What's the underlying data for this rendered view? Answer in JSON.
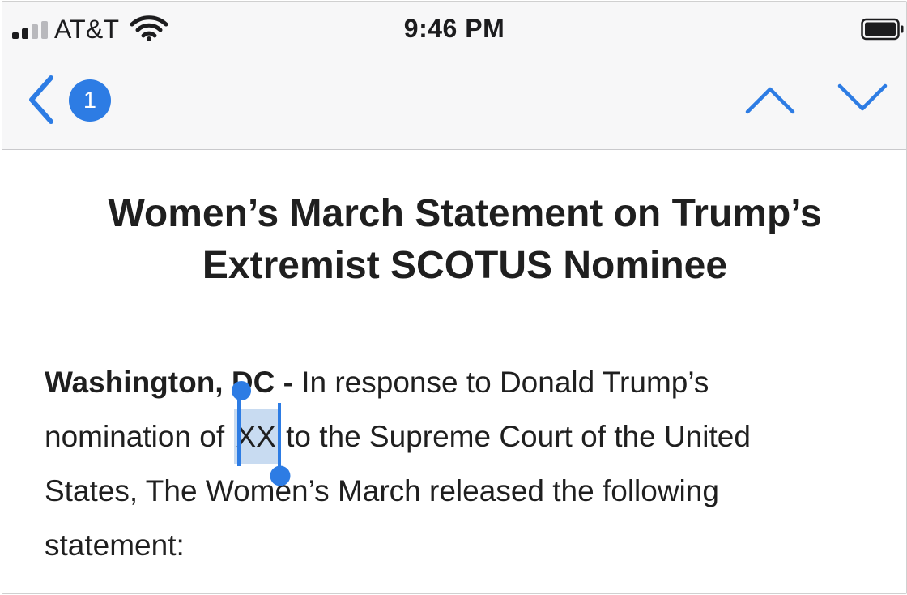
{
  "status_bar": {
    "carrier": "AT&T",
    "time": "9:46 PM",
    "signal_icon": "signal-bars-icon",
    "wifi_icon": "wifi-icon",
    "battery_icon": "battery-icon",
    "signal_bars_active": 2,
    "signal_bars_total": 4
  },
  "nav_bar": {
    "back_icon": "chevron-left-icon",
    "unread_count": "1",
    "previous_icon": "chevron-up-icon",
    "next_icon": "chevron-down-icon"
  },
  "email": {
    "title_line_1": "Women’s March Statement on Trump’s",
    "title_line_2": "Extremist SCOTUS Nominee",
    "body": {
      "dateline": "Washington, DC -",
      "line_1_rest": " In response to Donald Trump’s",
      "line_2_before": "nomination of ",
      "selected_text": "XX",
      "line_2_after": " to the Supreme Court of the United",
      "line_3": "States, The Women’s March released the following",
      "line_4": "statement:"
    }
  },
  "colors": {
    "accent": "#2d7ce4",
    "selection_highlight": "#c8dbf1",
    "text": "#1f1f1f",
    "bar_background": "#f7f7f8"
  }
}
